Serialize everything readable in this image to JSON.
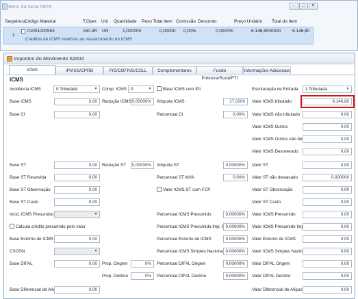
{
  "background_window": {
    "title": "Itens da Nota 5876",
    "columns": [
      "Sequência",
      "Código Material",
      "T.Oper.",
      "Uni",
      "Quantidade",
      "Peso Total Item",
      "Comissão",
      "Desconto",
      "Preço Unitário",
      "Total do Item"
    ],
    "row": {
      "sequence": "1",
      "material_code": "01001000553",
      "description": "Creditos de ICMS relativos ao ressarcimento do ICMS",
      "t_oper": "160.3R",
      "uni": "UN",
      "quantidade": "1,000000",
      "peso_total": "0,00000",
      "comissao": "0,00%",
      "desconto": "0,0000%",
      "preco_unitario": "6.146,8000000",
      "total_item": "6.146,80"
    }
  },
  "dialog": {
    "title": "Impostos do Movimento 62004",
    "tabs": [
      "ICMS",
      "IPI/ISS/CPRB",
      "PIS/COFINS/CSLL",
      "Complementares",
      "Fundo Pobreza/Rural/FTI",
      "Informações Adicionais"
    ],
    "active_tab": "ICMS",
    "section_title": "ICMS",
    "fields": {
      "incidencia_icms": {
        "label": "Incidência ICMS",
        "value": "0 Tributada"
      },
      "comp_icms": {
        "label": "Comp. ICMS",
        "value": "0"
      },
      "base_icms_ipi": {
        "label": "Base ICMS com IPI"
      },
      "escrituracao": {
        "label": "Escrituração de Entrada",
        "value": "1 Tributada"
      },
      "base_icms": {
        "label": "Base ICMS",
        "value": "0,00"
      },
      "reducao_icms": {
        "label": "Redução ICMS",
        "value": "0,00000%"
      },
      "aliquota_icms": {
        "label": "Alíquota ICMS",
        "value": "17,0000"
      },
      "valor_icms_tributado": {
        "label": "Valor ICMS tributado",
        "value": "6.146,80"
      },
      "base_ci": {
        "label": "Base CI",
        "value": "0,00"
      },
      "percentual_ci": {
        "label": "Percentual CI",
        "value": "0,00%"
      },
      "valor_icms_nao_tributado": {
        "label": "Valor ICMS não tributado",
        "value": "0,00"
      },
      "valor_icms_outros": {
        "label": "Valor ICMS Outros",
        "value": "0,00"
      },
      "valor_icms_outros_nao_dest": {
        "label": "Valor ICMS Outros não dest.",
        "value": "0,00"
      },
      "valor_icms_desonerado": {
        "label": "Valor ICMS Desonerado",
        "value": "0,00"
      },
      "base_st": {
        "label": "Base ST",
        "value": "0,00"
      },
      "reducao_st": {
        "label": "Redução ST",
        "value": "0,00000%"
      },
      "aliquota_st": {
        "label": "Alíquota ST",
        "value": "0,00000%"
      },
      "valor_st": {
        "label": "Valor ST",
        "value": "0,00"
      },
      "base_st_resolvida": {
        "label": "Base ST Resolvida",
        "value": "0,00"
      },
      "percentual_st_mva": {
        "label": "Percentual ST MVA",
        "value": "0,00%"
      },
      "valor_st_nao_destacado": {
        "label": "Valor ST não destacado",
        "value": "0,000000"
      },
      "base_st_observacao": {
        "label": "Base ST Observação",
        "value": "0,00"
      },
      "valor_icms_st_fcp": {
        "label": "Valor ICMS ST com FCP"
      },
      "valor_st_observacao": {
        "label": "Valor ST Observação",
        "value": "0,00"
      },
      "base_st_custo": {
        "label": "Base ST Custo",
        "value": "0,00"
      },
      "valor_st_custo": {
        "label": "Valor ST Custo",
        "value": "0,00"
      },
      "incid_icms_presumido": {
        "label": "Incid. ICMS Presumido"
      },
      "percentual_icms_presumido": {
        "label": "Percentual ICMS Presumido",
        "value": "0,00000%"
      },
      "valor_icms_presumido": {
        "label": "Valor ICMS Presumido",
        "value": "0,00"
      },
      "calcula_credito": {
        "label": "Calcula crédito presumido pelo valor"
      },
      "percentual_icms_presumido_impr": {
        "label": "Percentual ICMS Presumido Imp. PR",
        "value": "0,00000%"
      },
      "valor_icms_presumido_impr": {
        "label": "Valor ICMS Presumido Imp. PR",
        "value": "0,00"
      },
      "base_estorno": {
        "label": "Base Estorno de ICMS",
        "value": "0,00"
      },
      "percentual_estorno": {
        "label": "Percentual Estorno de ICMS",
        "value": "0,00000%"
      },
      "valor_estorno": {
        "label": "Valor Estorno de ICMS",
        "value": "0,00"
      },
      "csosn": {
        "label": "CSOSN"
      },
      "percentual_icms_simples": {
        "label": "Percentual ICMS Simples Nacional",
        "value": "0,00000%"
      },
      "valor_icms_simples": {
        "label": "Valor ICMS Simples Nacional",
        "value": "0,00"
      },
      "base_difal": {
        "label": "Base DIFAL",
        "value": "0,00"
      },
      "prop_origem": {
        "label": "Prop. Origem",
        "value": "0%"
      },
      "percentual_difal_origem": {
        "label": "Percentual DIFAL Origem",
        "value": "0,00000%"
      },
      "valor_difal_origem": {
        "label": "Valor DIFAL Origem",
        "value": "0,00"
      },
      "prop_destino": {
        "label": "Prop. Destino",
        "value": "0%"
      },
      "percentual_difal_destino": {
        "label": "Percentual DIFAL Destino",
        "value": "0,00000%"
      },
      "valor_difal_destino": {
        "label": "Valor DIFAL Destino",
        "value": "0,00"
      },
      "base_diferencial_aliq": {
        "label": "Base Diferencial de Alíq.",
        "value": "0,00"
      },
      "valor_diferencial_aliq": {
        "label": "Valor Diferencial de Alíquota",
        "value": "0,00"
      }
    }
  },
  "colors": {
    "highlight": "#d41414",
    "value_blue": "#2a4d8f"
  }
}
